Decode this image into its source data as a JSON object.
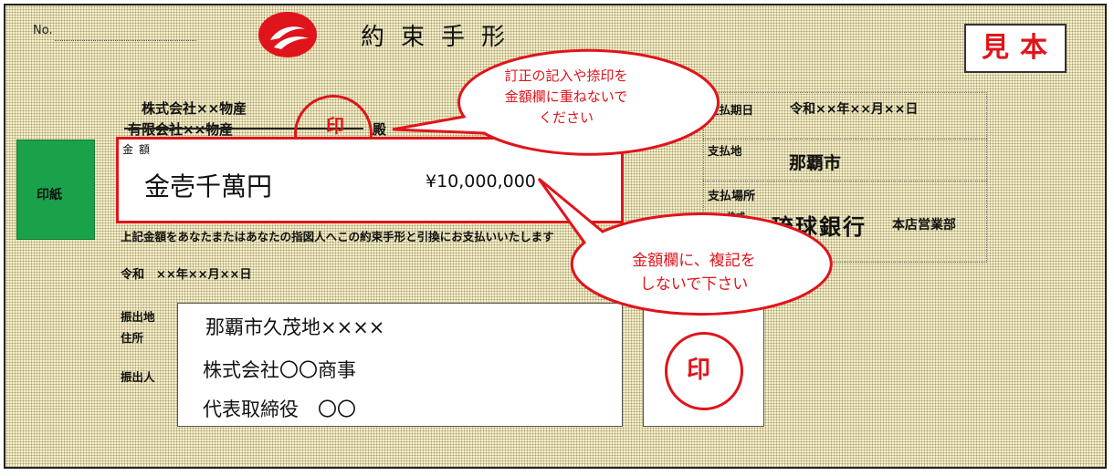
{
  "note": {
    "no_label": "No.",
    "title": "約束手形",
    "sample_mark": "見本",
    "payee_line1": "株式会社××物産",
    "payee_line2": "有限会社××物産",
    "payee_suffix": "殿",
    "stamp_char": "印",
    "revenue_stamp": "印紙",
    "amount_label": "金額",
    "amount_kanji": "金壱千萬円",
    "amount_number": "¥10,000,000",
    "promise_text": "上記金額をあなたまたはあなたの指図人へこの約束手形と引換にお支払いいたします",
    "issue_date": "令和　××年××月××日"
  },
  "payment": {
    "due_label": "支払期日",
    "due_value": "令和××年××月××日",
    "place_label": "支払地",
    "place_value": "那覇市",
    "location_label": "支払場所",
    "corp_label": "株式",
    "bank_name": "琉球銀行",
    "branch": "本店営業部"
  },
  "issuer": {
    "place_label": "振出地",
    "address_label": "住所",
    "drawer_label": "振出人",
    "address": "那覇市久茂地××××",
    "company": "株式会社〇〇商事",
    "representative": "代表取締役　〇〇"
  },
  "callouts": {
    "upper": [
      "訂正の記入や捺印を",
      "金額欄に重ねないで",
      "ください"
    ],
    "lower": [
      "金額欄に、複記を",
      "しないで下さい"
    ]
  },
  "colors": {
    "accent_red": "#e0141b",
    "paper": "#f6f0c8",
    "revenue_green": "#1aa24a"
  }
}
